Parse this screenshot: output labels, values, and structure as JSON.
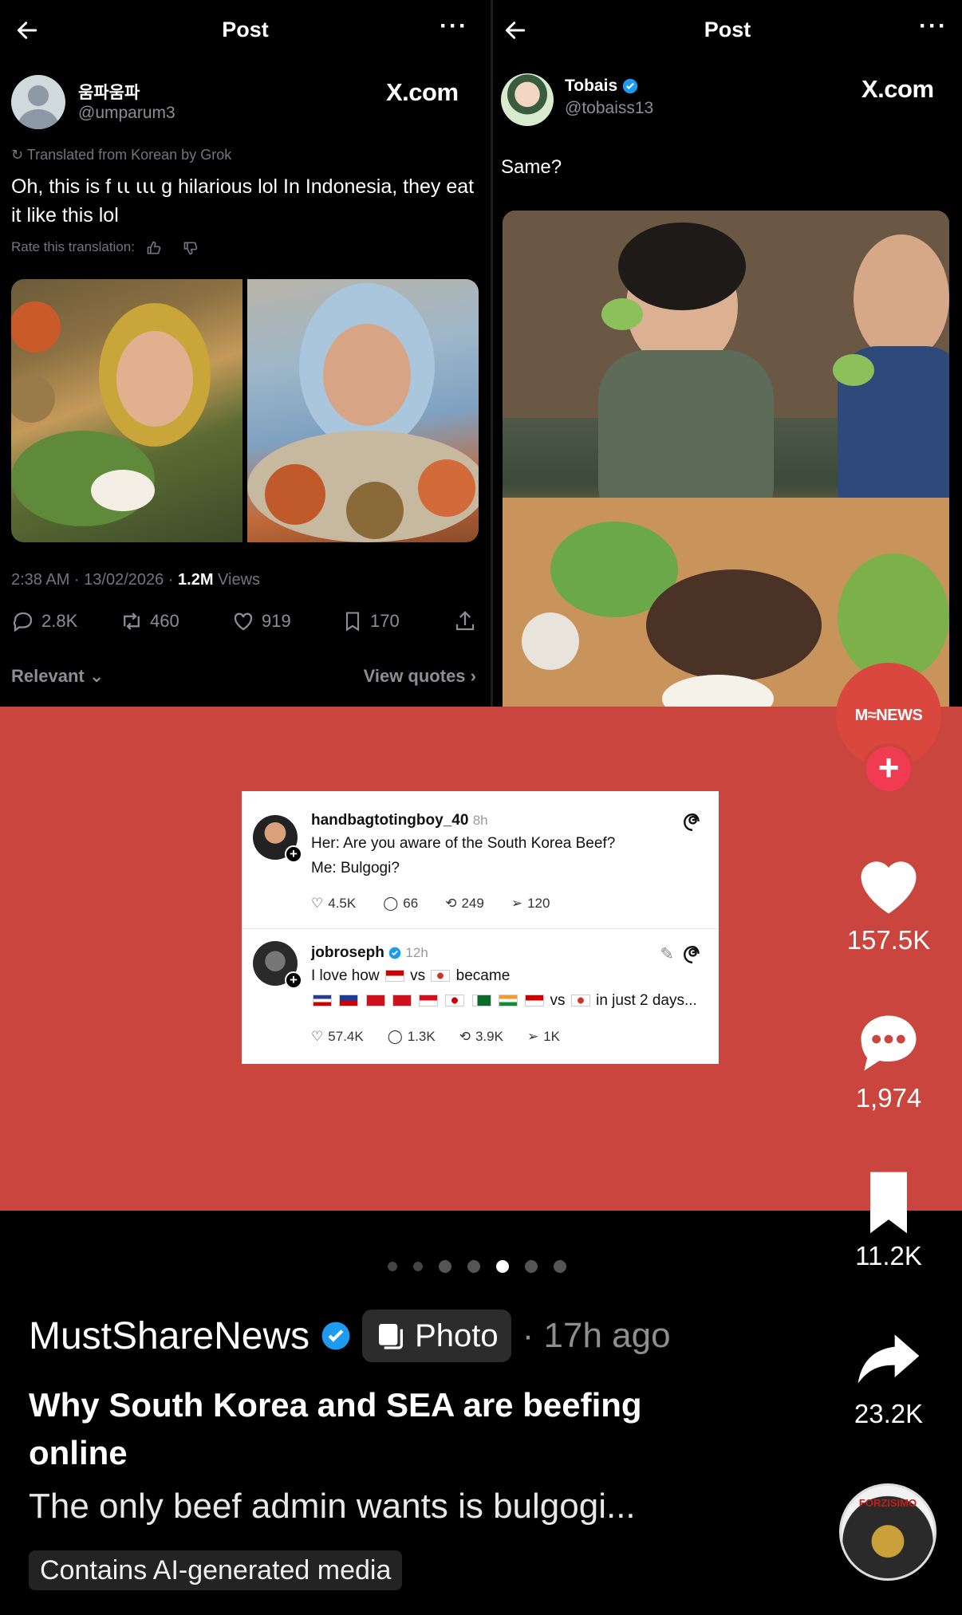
{
  "left_post": {
    "header_title": "Post",
    "user_name": "움파움파",
    "user_handle": "@umparum3",
    "source": "X.com",
    "translated_note": "Translated from Korean by Grok",
    "text": "Oh, this is f ꙇꙇ ꙇꙇꙇ g hilarious lol In Indonesia, they eat it like this lol",
    "rate_translation": "Rate this translation:",
    "time": "2:38 AM · 13/02/2026 · ",
    "views_count": "1.2M",
    "views_label": " Views",
    "replies": "2.8K",
    "reposts": "460",
    "likes": "919",
    "bookmarks": "170",
    "sort_label": "Relevant",
    "view_quotes": "View quotes"
  },
  "right_post": {
    "header_title": "Post",
    "user_name": "Tobais",
    "user_handle": "@tobaiss13",
    "source": "X.com",
    "text": "Same?"
  },
  "threads": [
    {
      "name": "handbagtotingboy_40",
      "time": "8h",
      "line1": "Her: Are you aware of the South Korea Beef?",
      "line2": "Me: Bulgogi?",
      "likes": "4.5K",
      "replies": "66",
      "reposts": "249",
      "shares": "120"
    },
    {
      "name": "jobroseph",
      "time": "12h",
      "line1_a": "I love how",
      "line1_b": "vs",
      "line1_c": "became",
      "line2_vs": "vs",
      "line2_end": "in just 2 days...",
      "likes": "57.4K",
      "replies": "1.3K",
      "reposts": "3.9K",
      "shares": "1K"
    }
  ],
  "rail": {
    "brand": "M≈NEWS",
    "likes": "157.5K",
    "comments": "1,974",
    "saves": "11.2K",
    "shares": "23.2K",
    "music_label": "FORZISIMO"
  },
  "carousel": {
    "count": 7,
    "active_index": 4
  },
  "info": {
    "author": "MustShareNews",
    "type_label": "Photo",
    "time_ago": "· 17h ago",
    "title": "Why South Korea and SEA are beefing online",
    "description": "The only beef admin wants is bulgogi...",
    "ai_label": "Contains AI-generated media"
  },
  "colors": {
    "background": "#000000",
    "red_panel": "#c9453d",
    "brand_red": "#d9473f",
    "follow_pink": "#f03b52",
    "verified_blue": "#1d9bf0"
  }
}
